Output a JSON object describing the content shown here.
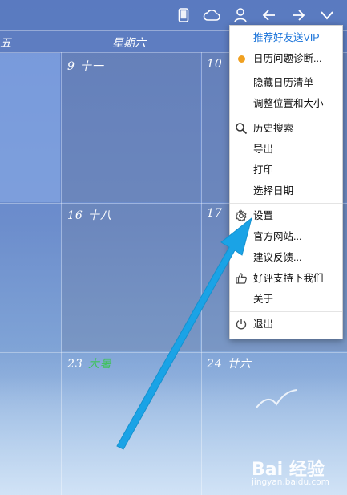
{
  "toolbar": {
    "icons": [
      "phone-icon",
      "cloud-icon",
      "user-icon",
      "arrow-left-icon",
      "arrow-right-icon",
      "chevron-down-icon"
    ]
  },
  "calendar": {
    "dow_headers": [
      "五",
      "星期六"
    ],
    "days": [
      {
        "num": "9",
        "lunar": "十一"
      },
      {
        "num": "10",
        "lunar": ""
      },
      {
        "num": "16",
        "lunar": "十八"
      },
      {
        "num": "17",
        "lunar": ""
      },
      {
        "num": "23",
        "term": "大暑"
      },
      {
        "num": "24",
        "lunar": "廿六"
      }
    ]
  },
  "menu": {
    "items": [
      {
        "label": "推荐好友送VIP",
        "icon": ""
      },
      {
        "label": "日历问题诊断...",
        "icon": "orange-dot"
      },
      {
        "label": "隐藏日历清单",
        "icon": ""
      },
      {
        "label": "调整位置和大小",
        "icon": ""
      },
      {
        "label": "历史搜索",
        "icon": "search-icon"
      },
      {
        "label": "导出",
        "icon": ""
      },
      {
        "label": "打印",
        "icon": ""
      },
      {
        "label": "选择日期",
        "icon": ""
      },
      {
        "label": "设置",
        "icon": "gear-icon"
      },
      {
        "label": "官方网站...",
        "icon": ""
      },
      {
        "label": "建议反馈...",
        "icon": ""
      },
      {
        "label": "好评支持下我们",
        "icon": "thumbs-up-icon"
      },
      {
        "label": "关于",
        "icon": ""
      },
      {
        "label": "退出",
        "icon": "power-icon"
      }
    ],
    "colors": {
      "vip": "#1a73d9",
      "dot": "#f0a020"
    }
  },
  "watermark": {
    "name": "Bai 经验",
    "url": "jingyan.baidu.com"
  },
  "colors": {
    "annotation_arrow": "#1aa3e6",
    "solar_term": "#3fc35a"
  }
}
